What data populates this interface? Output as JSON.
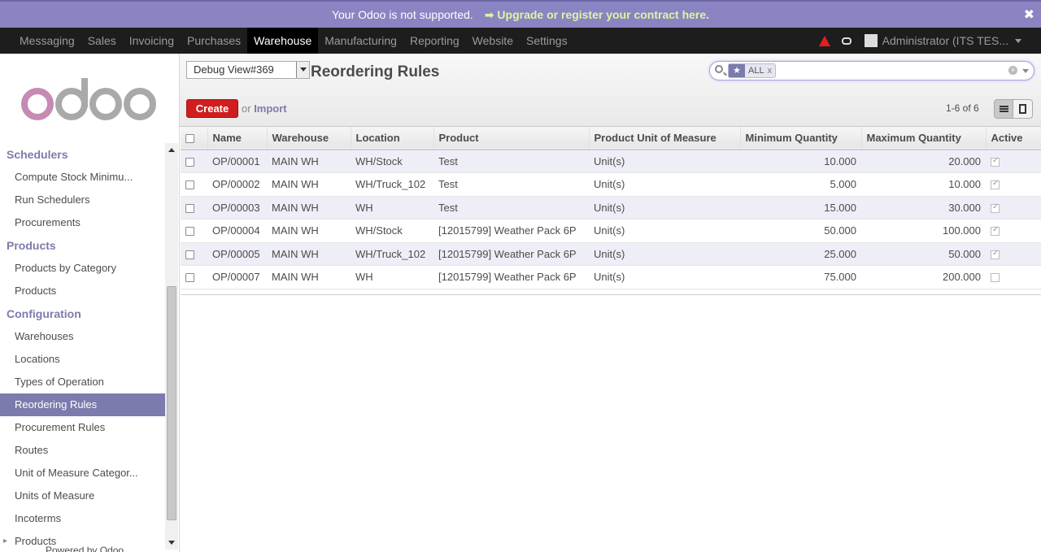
{
  "announcement": {
    "text": "Your Odoo is not supported.",
    "link": "➡ Upgrade or register your contract here.",
    "close": "✖"
  },
  "topmenu": {
    "items": [
      "Messaging",
      "Sales",
      "Invoicing",
      "Purchases",
      "Warehouse",
      "Manufacturing",
      "Reporting",
      "Website",
      "Settings"
    ],
    "active": "Warehouse",
    "user": "Administrator (ITS  TES..."
  },
  "sidebar": {
    "logo": "odoo",
    "sections": [
      {
        "heading": "Schedulers",
        "items": [
          "Compute Stock Minimu...",
          "Run Schedulers",
          "Procurements"
        ]
      },
      {
        "heading": "Products",
        "items": [
          "Products by Category",
          "Products"
        ]
      },
      {
        "heading": "Configuration",
        "items": [
          "Warehouses",
          "Locations",
          "Types of Operation",
          "Reordering Rules",
          "Procurement Rules",
          "Routes",
          "Unit of Measure Categor...",
          "Units of Measure",
          "Incoterms"
        ]
      }
    ],
    "tree_item": "Products",
    "active_item": "Reordering Rules",
    "powered_by": "Powered by Odoo"
  },
  "header": {
    "debug_view": "Debug View#369",
    "title": "Reordering Rules",
    "search": {
      "facet_label": "ALL",
      "facet_remove": "x",
      "value": ""
    },
    "create_label": "Create",
    "or_text": "or",
    "import_label": "Import",
    "pager": "1-6 of 6"
  },
  "table": {
    "columns": [
      "Name",
      "Warehouse",
      "Location",
      "Product",
      "Product Unit of Measure",
      "Minimum Quantity",
      "Maximum Quantity",
      "Active"
    ],
    "rows": [
      {
        "name": "OP/00001",
        "warehouse": "MAIN WH",
        "location": "WH/Stock",
        "product": "Test",
        "uom": "Unit(s)",
        "min": "10.000",
        "max": "20.000",
        "active": true
      },
      {
        "name": "OP/00002",
        "warehouse": "MAIN WH",
        "location": "WH/Truck_102",
        "product": "Test",
        "uom": "Unit(s)",
        "min": "5.000",
        "max": "10.000",
        "active": true
      },
      {
        "name": "OP/00003",
        "warehouse": "MAIN WH",
        "location": "WH",
        "product": "Test",
        "uom": "Unit(s)",
        "min": "15.000",
        "max": "30.000",
        "active": true
      },
      {
        "name": "OP/00004",
        "warehouse": "MAIN WH",
        "location": "WH/Stock",
        "product": "[12015799] Weather Pack 6P",
        "uom": "Unit(s)",
        "min": "50.000",
        "max": "100.000",
        "active": true
      },
      {
        "name": "OP/00005",
        "warehouse": "MAIN WH",
        "location": "WH/Truck_102",
        "product": "[12015799] Weather Pack 6P",
        "uom": "Unit(s)",
        "min": "25.000",
        "max": "50.000",
        "active": true
      },
      {
        "name": "OP/00007",
        "warehouse": "MAIN WH",
        "location": "WH",
        "product": "[12015799] Weather Pack 6P",
        "uom": "Unit(s)",
        "min": "75.000",
        "max": "200.000",
        "active": false
      }
    ]
  },
  "colors": {
    "brand": "#7c7bad",
    "announce_bg": "#8a84c2",
    "create_btn": "#d01e1e",
    "topbar": "#1d1d1d"
  }
}
